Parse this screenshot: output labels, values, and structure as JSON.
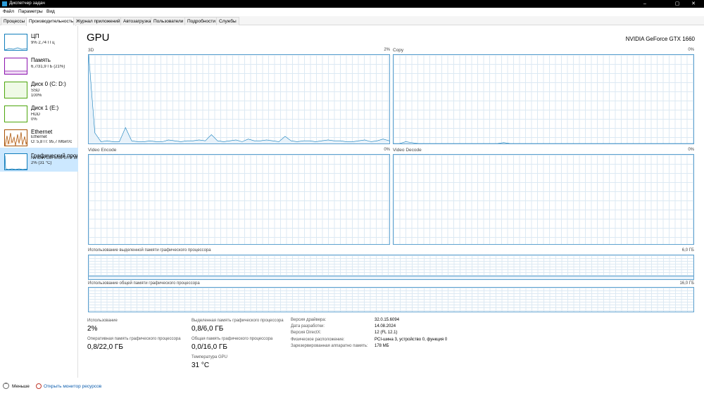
{
  "window": {
    "title": "Диспетчер задач",
    "minimize": "–",
    "maximize": "▢",
    "close": "✕"
  },
  "menu": [
    "Файл",
    "Параметры",
    "Вид"
  ],
  "tabs": [
    "Процессы",
    "Производительность",
    "Журнал приложений",
    "Автозагрузка",
    "Пользователи",
    "Подробности",
    "Службы"
  ],
  "sidebar": {
    "items": [
      {
        "title": "ЦП",
        "sub1": "9% 2,74 ГГц",
        "sub2": "",
        "sub3": "",
        "color": "#117dbb"
      },
      {
        "title": "Память",
        "sub1": "6,7/31,9 ГБ (21%)",
        "sub2": "",
        "sub3": "",
        "color": "#8b12ae"
      },
      {
        "title": "Диск 0 (C: D:)",
        "sub1": "SSD",
        "sub2": "100%",
        "sub3": "",
        "color": "#4da60c"
      },
      {
        "title": "Диск 1 (E:)",
        "sub1": "HDD",
        "sub2": "0%",
        "sub3": "",
        "color": "#4da60c"
      },
      {
        "title": "Ethernet",
        "sub1": "Ethernet",
        "sub2": "О: 5,8 П: 95,7 Мбит/с",
        "sub3": "",
        "color": "#a74f01"
      },
      {
        "title": "Графический процессор 0",
        "sub1": "NVIDIA GeForce GTX 1660",
        "sub2": "2% (31 °C)",
        "sub3": "",
        "color": "#117dbb"
      }
    ]
  },
  "main": {
    "title": "GPU",
    "model": "NVIDIA GeForce GTX 1660",
    "engines": [
      {
        "name": "3D",
        "pct": "2%",
        "values": [
          100,
          12,
          2,
          3,
          2,
          2,
          18,
          3,
          2,
          2,
          3,
          2,
          2,
          4,
          3,
          2,
          3,
          3,
          4,
          3,
          10,
          3,
          2,
          3,
          4,
          2,
          5,
          3,
          3,
          4,
          3,
          2,
          8,
          3,
          2,
          3,
          3,
          2,
          3,
          4,
          3,
          3,
          2,
          2,
          3,
          4,
          2,
          3,
          5,
          3
        ]
      },
      {
        "name": "Copy",
        "pct": "0%",
        "values": [
          0,
          0,
          2,
          1,
          0,
          0,
          0,
          0,
          0,
          0,
          0,
          0,
          0,
          0,
          0,
          0,
          0,
          0,
          1,
          0,
          0,
          0,
          0,
          0,
          0,
          0,
          0,
          0,
          0,
          0,
          0,
          0,
          0,
          0,
          0,
          0,
          0,
          0,
          0,
          0,
          0,
          0,
          0,
          0,
          0,
          0,
          0,
          0,
          0,
          0
        ]
      },
      {
        "name": "Video Encode",
        "pct": "0%",
        "values": []
      },
      {
        "name": "Video Decode",
        "pct": "0%",
        "values": []
      }
    ],
    "dedicated_mem": {
      "label": "Использование выделенной памяти графического процессора",
      "max": "6,0 ГБ"
    },
    "shared_mem": {
      "label": "Использование общей памяти графического процессора",
      "max": "16,0 ГБ"
    },
    "stats": {
      "usage_label": "Использование",
      "usage_value": "2%",
      "gpu_mem_label": "Оперативная память графического процессора",
      "gpu_mem_value": "0,8/22,0 ГБ",
      "dedicated_label": "Выделенная память графического процессора",
      "dedicated_value": "0,8/6,0 ГБ",
      "shared_label": "Общая память графического процессора",
      "shared_value": "0,0/16,0 ГБ",
      "temp_label": "Температура GPU",
      "temp_value": "31 °C"
    },
    "info": [
      {
        "label": "Версия драйвера:",
        "value": "32.0.15.6094"
      },
      {
        "label": "Дата разработки:",
        "value": "14.08.2024"
      },
      {
        "label": "Версия DirectX:",
        "value": "12 (FL 12.1)"
      },
      {
        "label": "Физическое расположение:",
        "value": "PCI-шина 3, устройство 0, функция 0"
      },
      {
        "label": "Зарезервированная аппаратно память:",
        "value": "178 МБ"
      }
    ]
  },
  "footer": {
    "less": "Меньше",
    "open_monitor": "Открыть монитор ресурсов"
  }
}
